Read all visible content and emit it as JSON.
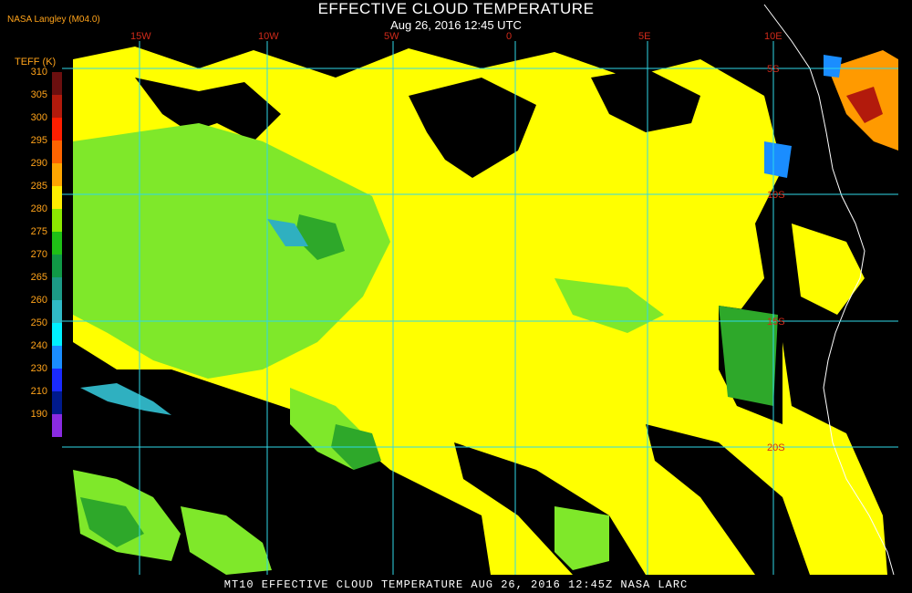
{
  "header": {
    "title": "EFFECTIVE CLOUD TEMPERATURE",
    "subtitle": "Aug 26, 2016 12:45 UTC",
    "producer": "NASA Langley (M04.0)"
  },
  "legend": {
    "title": "TEFF (K)",
    "entries": [
      {
        "label": "310",
        "color": "#6b0f0f"
      },
      {
        "label": "305",
        "color": "#b21a0c"
      },
      {
        "label": "300",
        "color": "#ff1e00"
      },
      {
        "label": "295",
        "color": "#ff6400"
      },
      {
        "label": "290",
        "color": "#ffa500"
      },
      {
        "label": "285",
        "color": "#ffee00"
      },
      {
        "label": "280",
        "color": "#8ce800"
      },
      {
        "label": "275",
        "color": "#1fbf16"
      },
      {
        "label": "270",
        "color": "#109846"
      },
      {
        "label": "265",
        "color": "#1c9a86"
      },
      {
        "label": "260",
        "color": "#30b9c6"
      },
      {
        "label": "250",
        "color": "#00f0ff"
      },
      {
        "label": "240",
        "color": "#1a8dff"
      },
      {
        "label": "230",
        "color": "#1a2aff"
      },
      {
        "label": "210",
        "color": "#001a8c"
      },
      {
        "label": "190",
        "color": "#8a2be2"
      }
    ]
  },
  "map": {
    "longitude_labels": [
      "15W",
      "10W",
      "5W",
      "0",
      "5E",
      "10E"
    ],
    "latitude_labels": [
      "5S",
      "10S",
      "15S",
      "20S"
    ],
    "grid_color": "#2fd8e8",
    "coast_color": "#ffffff",
    "cloud_colors": {
      "warm_yellow": "#ffff00",
      "low_green": "#7fe82a",
      "mid_green": "#2ea82a",
      "cyan": "#2fb0c0",
      "orange": "#ff9a00"
    }
  },
  "footer": {
    "caption": "MT10  EFFECTIVE CLOUD TEMPERATURE  AUG 26, 2016 12:45Z  NASA LARC"
  }
}
